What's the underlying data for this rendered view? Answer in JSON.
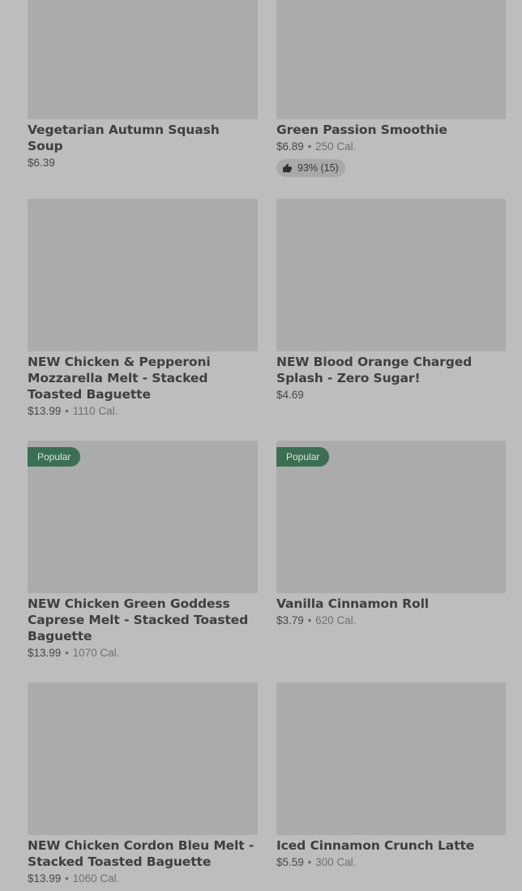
{
  "items": [
    {
      "name": "Vegetarian Autumn Squash Soup",
      "price": "$6.39",
      "calories": "",
      "badge": ""
    },
    {
      "name": "Green Passion Smoothie",
      "price": "$6.89",
      "calories": "250 Cal.",
      "badge": "",
      "rating": "93% (15)"
    },
    {
      "name": "NEW Chicken & Pepperoni Mozzarella Melt - Stacked Toasted Baguette",
      "price": "$13.99",
      "calories": "1110 Cal.",
      "badge": ""
    },
    {
      "name": "NEW Blood Orange Charged Splash - Zero Sugar!",
      "price": "$4.69",
      "calories": "",
      "badge": ""
    },
    {
      "name": "NEW Chicken Green Goddess Caprese Melt - Stacked Toasted Baguette",
      "price": "$13.99",
      "calories": "1070 Cal.",
      "badge": "Popular"
    },
    {
      "name": "Vanilla Cinnamon Roll",
      "price": "$3.79",
      "calories": "620 Cal.",
      "badge": "Popular"
    },
    {
      "name": "NEW Chicken Cordon Bleu Melt - Stacked Toasted Baguette",
      "price": "$13.99",
      "calories": "1060 Cal.",
      "badge": ""
    },
    {
      "name": "Iced Cinnamon Crunch Latte",
      "price": "$5.59",
      "calories": "300 Cal.",
      "badge": ""
    }
  ],
  "separator": "•",
  "icons": {
    "rating": "thumbs-up-icon"
  }
}
